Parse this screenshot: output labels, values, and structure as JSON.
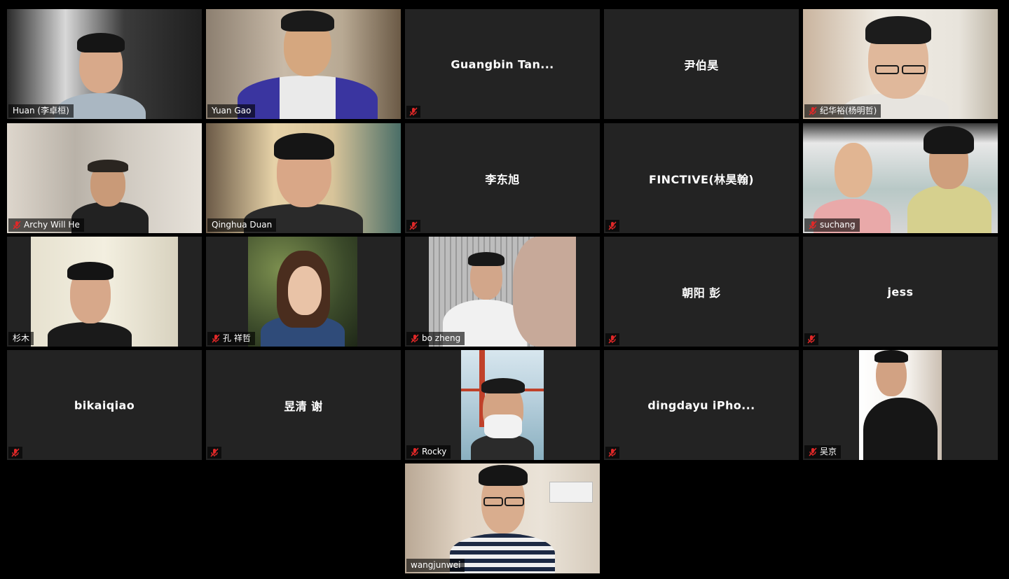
{
  "window": {
    "title": ""
  },
  "colors": {
    "mute_red": "#e02828",
    "active_speaker": "#e7ef7c",
    "tile_bg": "#232323"
  },
  "participants": [
    {
      "name": "Huan (李卓桓)",
      "video": true,
      "muted": false,
      "display": ""
    },
    {
      "name": "Yuan Gao",
      "video": true,
      "muted": false,
      "display": ""
    },
    {
      "name": "",
      "video": false,
      "muted": true,
      "display": "Guangbin Tan..."
    },
    {
      "name": "",
      "video": false,
      "muted": false,
      "display": "尹伯昊"
    },
    {
      "name": "纪华裕(杨明哲)",
      "video": true,
      "muted": true,
      "display": ""
    },
    {
      "name": "Archy Will He",
      "video": true,
      "muted": true,
      "display": ""
    },
    {
      "name": "Qinghua Duan",
      "video": true,
      "muted": false,
      "display": "",
      "active": true
    },
    {
      "name": "",
      "video": false,
      "muted": true,
      "display": "李东旭"
    },
    {
      "name": "",
      "video": false,
      "muted": true,
      "display": "FINCTIVE(林昊翰)"
    },
    {
      "name": "suchang",
      "video": true,
      "muted": true,
      "display": ""
    },
    {
      "name": "杉木",
      "video": true,
      "muted": false,
      "display": ""
    },
    {
      "name": "孔 祥哲",
      "video": true,
      "muted": true,
      "display": ""
    },
    {
      "name": "bo zheng",
      "video": true,
      "muted": true,
      "display": ""
    },
    {
      "name": "",
      "video": false,
      "muted": true,
      "display": "朝阳 彭"
    },
    {
      "name": "",
      "video": false,
      "muted": true,
      "display": "jess"
    },
    {
      "name": "",
      "video": false,
      "muted": true,
      "display": "bikaiqiao"
    },
    {
      "name": "",
      "video": false,
      "muted": true,
      "display": "昱清 谢"
    },
    {
      "name": "Rocky",
      "video": true,
      "muted": true,
      "display": ""
    },
    {
      "name": "",
      "video": false,
      "muted": true,
      "display": "dingdayu iPho..."
    },
    {
      "name": "吴京",
      "video": true,
      "muted": true,
      "display": ""
    },
    {
      "name": "wangjunwei",
      "video": true,
      "muted": false,
      "display": ""
    }
  ]
}
